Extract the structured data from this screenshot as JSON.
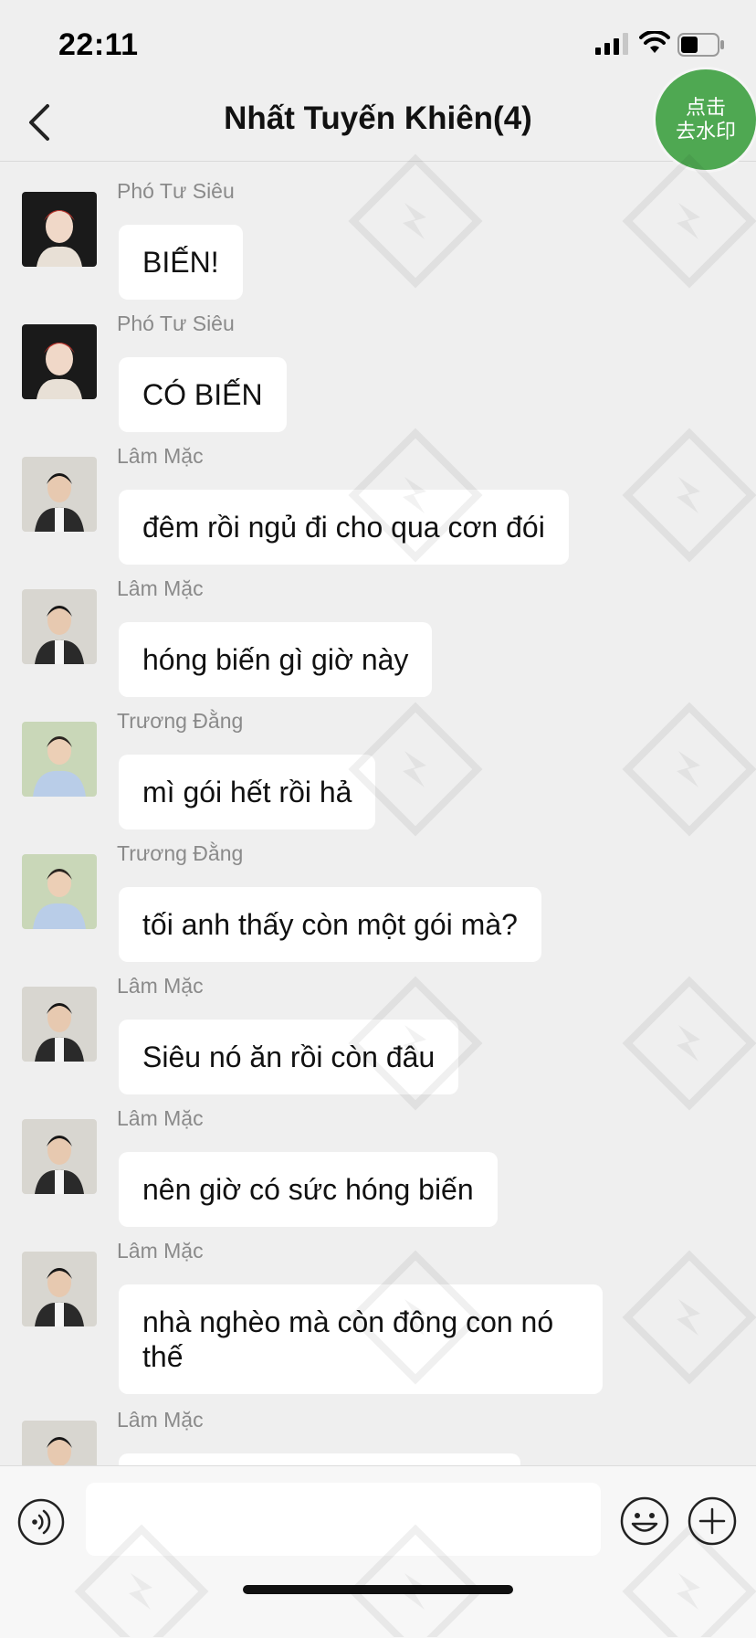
{
  "status_bar": {
    "time": "22:11"
  },
  "header": {
    "title": "Nhất Tuyến Khiên(4)",
    "back_icon": "chevron-left-icon"
  },
  "remove_watermark": {
    "line1": "点击",
    "line2": "去水印",
    "color": "#4fa852"
  },
  "messages": [
    {
      "sender": "Phó Tư Siêu",
      "text": "BIẾN!",
      "avatar": "red-hair"
    },
    {
      "sender": "Phó Tư Siêu",
      "text": "CÓ BIẾN",
      "avatar": "red-hair"
    },
    {
      "sender": "Lâm Mặc",
      "text": "đêm rồi ngủ đi cho qua cơn đói",
      "avatar": "dark-suit"
    },
    {
      "sender": "Lâm Mặc",
      "text": "hóng biến gì giờ này",
      "avatar": "dark-suit"
    },
    {
      "sender": "Trương Đằng",
      "text": "mì gói hết rồi hả",
      "avatar": "blue-shirt"
    },
    {
      "sender": "Trương Đằng",
      "text": "tối anh thấy còn một gói mà?",
      "avatar": "blue-shirt"
    },
    {
      "sender": "Lâm Mặc",
      "text": "Siêu nó ăn rồi còn đâu",
      "avatar": "dark-suit"
    },
    {
      "sender": "Lâm Mặc",
      "text": "nên giờ có sức hóng biến",
      "avatar": "dark-suit"
    },
    {
      "sender": "Lâm Mặc",
      "text": "nhà nghèo mà còn đông con nó thế",
      "avatar": "dark-suit"
    },
    {
      "sender": "Lâm Mặc",
      "text": "",
      "avatar": "dark-suit"
    }
  ],
  "input": {
    "value": "",
    "placeholder": ""
  },
  "icons": {
    "voice": "voice-icon",
    "emoji": "emoji-icon",
    "plus": "plus-icon"
  }
}
